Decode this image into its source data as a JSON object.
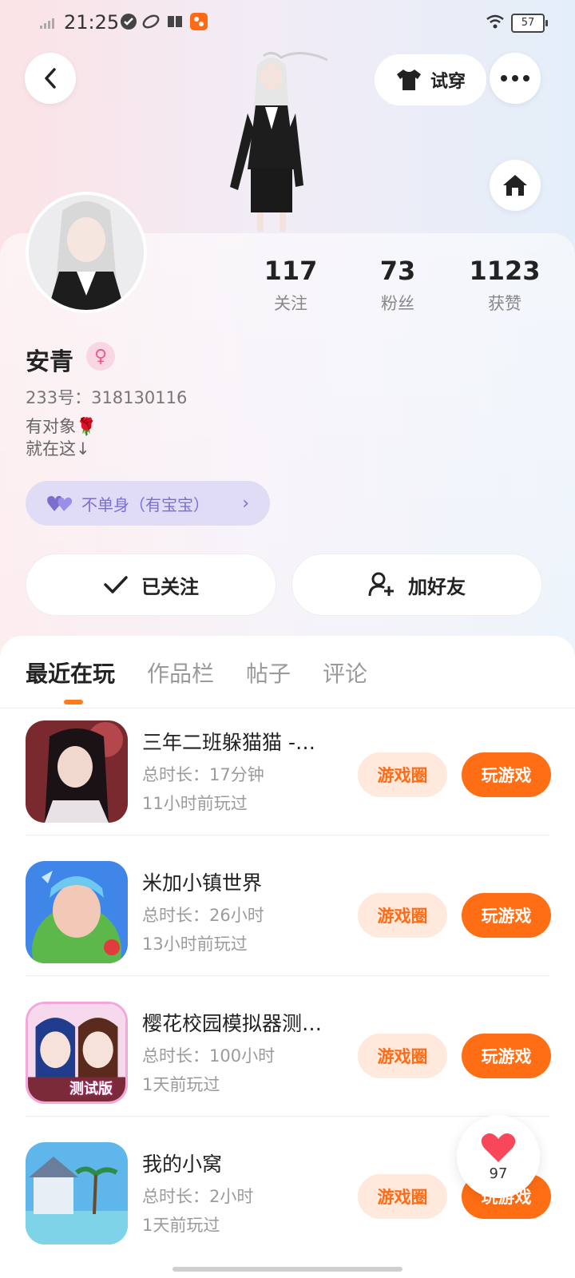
{
  "status_bar": {
    "time": "21:25",
    "battery": "57"
  },
  "header": {
    "tryon_label": "试穿"
  },
  "stats": [
    {
      "value": "117",
      "label": "关注"
    },
    {
      "value": "73",
      "label": "粉丝"
    },
    {
      "value": "1123",
      "label": "获赞"
    }
  ],
  "profile": {
    "name": "安青",
    "id_text": "233号：318130116",
    "bio_line1": "有对象🌹",
    "bio_line2": "就在这↓",
    "relationship": "不单身（有宝宝）"
  },
  "actions": {
    "followed_label": "已关注",
    "add_friend_label": "加好友"
  },
  "tabs": [
    "最近在玩",
    "作品栏",
    "帖子",
    "评论"
  ],
  "games": [
    {
      "title": "三年二班躲猫猫 -…",
      "duration": "总时长：17分钟",
      "last_played": "11小时前玩过",
      "circle_label": "游戏圈",
      "play_label": "玩游戏"
    },
    {
      "title": "米加小镇世界",
      "duration": "总时长：26小时",
      "last_played": "13小时前玩过",
      "circle_label": "游戏圈",
      "play_label": "玩游戏"
    },
    {
      "title": "樱花校园模拟器测…",
      "duration": "总时长：100小时",
      "last_played": "1天前玩过",
      "circle_label": "游戏圈",
      "play_label": "玩游戏"
    },
    {
      "title": "我的小窝",
      "duration": "总时长：2小时",
      "last_played": "1天前玩过",
      "circle_label": "游戏圈",
      "play_label": "玩游戏"
    }
  ],
  "game_icon_text": {
    "test_version": "测试版"
  },
  "like_float": {
    "count": "97"
  },
  "colors": {
    "accent": "#ff6e14",
    "accent_light": "#ffe9dc",
    "relationship_bg": "#e1dcf6",
    "relationship_text": "#7a6fd1"
  }
}
